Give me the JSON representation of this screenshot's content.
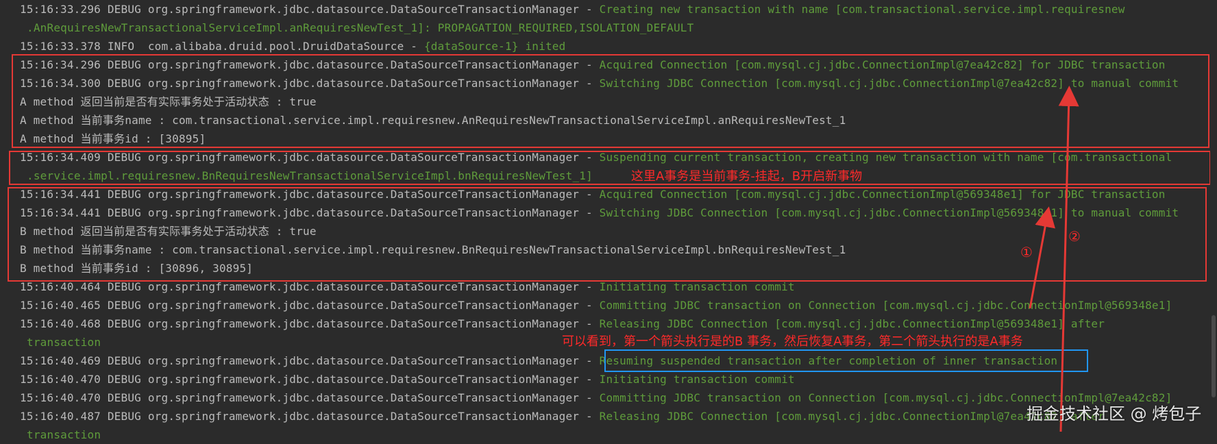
{
  "log_lines": [
    {
      "prefix": "15:16:33.296 DEBUG org.springframework.jdbc.datasource.DataSourceTransactionManager - ",
      "msg": "Creating new transaction with name [com.transactional.service.impl.requiresnew"
    },
    {
      "prefix": "",
      "msg": ".AnRequiresNewTransactionalServiceImpl.anRequiresNewTest_1]: PROPAGATION_REQUIRED,ISOLATION_DEFAULT"
    },
    {
      "prefix": "15:16:33.378 INFO  com.alibaba.druid.pool.DruidDataSource - ",
      "msg": "{dataSource-1} inited"
    },
    {
      "prefix": "15:16:34.296 DEBUG org.springframework.jdbc.datasource.DataSourceTransactionManager - ",
      "msg": "Acquired Connection [com.mysql.cj.jdbc.ConnectionImpl@7ea42c82] for JDBC transaction"
    },
    {
      "prefix": "15:16:34.300 DEBUG org.springframework.jdbc.datasource.DataSourceTransactionManager - ",
      "msg": "Switching JDBC Connection [com.mysql.cj.jdbc.ConnectionImpl@7ea42c82] to manual commit"
    },
    {
      "prefix": "A method 返回当前是否有实际事务处于活动状态 : true",
      "msg": ""
    },
    {
      "prefix": "A method 当前事务name : com.transactional.service.impl.requiresnew.AnRequiresNewTransactionalServiceImpl.anRequiresNewTest_1",
      "msg": ""
    },
    {
      "prefix": "A method 当前事务id : [30895]",
      "msg": ""
    },
    {
      "prefix": "15:16:34.409 DEBUG org.springframework.jdbc.datasource.DataSourceTransactionManager - ",
      "msg": "Suspending current transaction, creating new transaction with name [com.transactional"
    },
    {
      "prefix": "",
      "msg": ".service.impl.requiresnew.BnRequiresNewTransactionalServiceImpl.bnRequiresNewTest_1]"
    },
    {
      "prefix": "15:16:34.441 DEBUG org.springframework.jdbc.datasource.DataSourceTransactionManager - ",
      "msg": "Acquired Connection [com.mysql.cj.jdbc.ConnectionImpl@569348e1] for JDBC transaction"
    },
    {
      "prefix": "15:16:34.441 DEBUG org.springframework.jdbc.datasource.DataSourceTransactionManager - ",
      "msg": "Switching JDBC Connection [com.mysql.cj.jdbc.ConnectionImpl@569348e1] to manual commit"
    },
    {
      "prefix": "B method 返回当前是否有实际事务处于活动状态 : true",
      "msg": ""
    },
    {
      "prefix": "B method 当前事务name : com.transactional.service.impl.requiresnew.BnRequiresNewTransactionalServiceImpl.bnRequiresNewTest_1",
      "msg": ""
    },
    {
      "prefix": "B method 当前事务id : [30896, 30895]",
      "msg": ""
    },
    {
      "prefix": "15:16:40.464 DEBUG org.springframework.jdbc.datasource.DataSourceTransactionManager - ",
      "msg": "Initiating transaction commit"
    },
    {
      "prefix": "15:16:40.465 DEBUG org.springframework.jdbc.datasource.DataSourceTransactionManager - ",
      "msg": "Committing JDBC transaction on Connection [com.mysql.cj.jdbc.ConnectionImpl@569348e1]"
    },
    {
      "prefix": "15:16:40.468 DEBUG org.springframework.jdbc.datasource.DataSourceTransactionManager - ",
      "msg": "Releasing JDBC Connection [com.mysql.cj.jdbc.ConnectionImpl@569348e1] after"
    },
    {
      "prefix": "",
      "msg": "transaction"
    },
    {
      "prefix": "15:16:40.469 DEBUG org.springframework.jdbc.datasource.DataSourceTransactionManager - ",
      "msg": "Resuming suspended transaction after completion of inner transaction"
    },
    {
      "prefix": "15:16:40.470 DEBUG org.springframework.jdbc.datasource.DataSourceTransactionManager - ",
      "msg": "Initiating transaction commit"
    },
    {
      "prefix": "15:16:40.470 DEBUG org.springframework.jdbc.datasource.DataSourceTransactionManager - ",
      "msg": "Committing JDBC transaction on Connection [com.mysql.cj.jdbc.ConnectionImpl@7ea42c82]"
    },
    {
      "prefix": "15:16:40.487 DEBUG org.springframework.jdbc.datasource.DataSourceTransactionManager - ",
      "msg": "Releasing JDBC Connection [com.mysql.cj.jdbc.ConnectionImpl@7ea42c82] after"
    },
    {
      "prefix": "",
      "msg": "transaction"
    }
  ],
  "annotations": {
    "note_suspend": "这里A事务是当前事务-挂起，B开启新事物",
    "note_summary": "可以看到，第一个箭头执行是的B 事务，然后恢复A事务，第二个箭头执行的是A事务",
    "marker_1": "①",
    "marker_2": "②"
  },
  "watermark": "掘金技术社区 @ 烤包子",
  "colors": {
    "background": "#2b2b2b",
    "log_text": "#bbbbbb",
    "log_message": "#5f9c3b",
    "annotation_red": "#e53935",
    "annotation_blue": "#2196f3"
  }
}
